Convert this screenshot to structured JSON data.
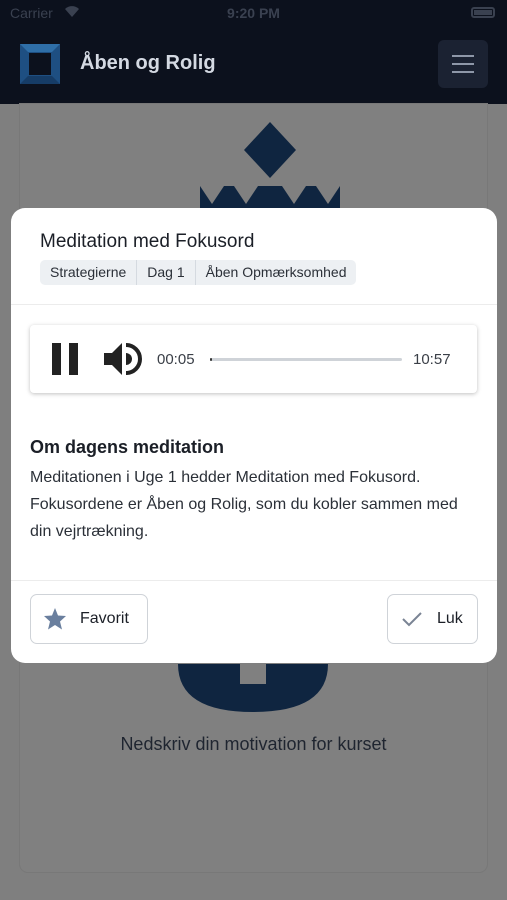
{
  "status_bar": {
    "carrier": "Carrier",
    "time": "9:20 PM"
  },
  "header": {
    "app_title": "Åben og Rolig"
  },
  "background": {
    "motivation_text": "Nedskriv din motivation for kurset"
  },
  "modal": {
    "title": "Meditation med Fokusord",
    "tags": [
      "Strategierne",
      "Dag 1",
      "Åben Opmærksomhed"
    ],
    "player": {
      "current_time": "00:05",
      "total_time": "10:57",
      "progress": 0.008
    },
    "about_title": "Om dagens meditation",
    "about_text": "Meditationen i Uge 1 hedder Meditation med Fokusord. Fokusordene er Åben og Rolig, som du kobler sammen med din vejrtrækning.",
    "favorite_label": "Favorit",
    "close_label": "Luk"
  },
  "colors": {
    "nav_bg": "#0c111d",
    "brand_blue": "#1b3a6b",
    "icon_star": "#6a7f9e"
  }
}
